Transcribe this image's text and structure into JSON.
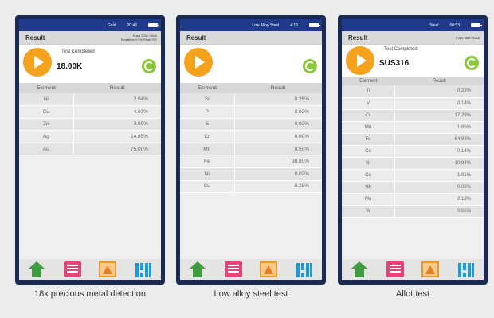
{
  "devices": [
    {
      "status_title": "Gold",
      "status_time": "20:46",
      "result_label": "Result",
      "params_line1": "0 cps 37kV 40uA",
      "params_line2": "Deadtime 0.5% Peak 971",
      "test_status": "Test Completed",
      "sample_name": "18.00K",
      "table_header": [
        "Element",
        "Result"
      ],
      "rows": [
        [
          "Ni",
          "2.04%"
        ],
        [
          "Cu",
          "4.03%"
        ],
        [
          "Zn",
          "3.99%"
        ],
        [
          "Ag",
          "14.85%"
        ],
        [
          "Au",
          "75.00%"
        ]
      ],
      "caption": "18k precious metal detection"
    },
    {
      "status_title": "Low Alloy Steel",
      "status_time": "4:16",
      "result_label": "Result",
      "params_line1": "",
      "params_line2": "",
      "test_status": "",
      "sample_name": "",
      "table_header": [
        "Element",
        "Result"
      ],
      "rows": [
        [
          "Si",
          "0.26%"
        ],
        [
          "P",
          "0.02%"
        ],
        [
          "S",
          "0.02%"
        ],
        [
          "Cr",
          "0.00%"
        ],
        [
          "Mn",
          "0.50%"
        ],
        [
          "Fe",
          "98.80%"
        ],
        [
          "Ni",
          "0.02%"
        ],
        [
          "Cu",
          "0.28%"
        ]
      ],
      "caption": "Low alloy steel test"
    },
    {
      "status_title": "Steel",
      "status_time": "00:53",
      "result_label": "Result",
      "params_line1": "0 cps 38kV 51uA",
      "params_line2": "",
      "test_status": "Test Completed",
      "sample_name": "SUS316",
      "table_header": [
        "Element",
        "Result"
      ],
      "rows": [
        [
          "Ti",
          "0.23%"
        ],
        [
          "V",
          "0.14%"
        ],
        [
          "Cr",
          "17.29%"
        ],
        [
          "Mn",
          "1.85%"
        ],
        [
          "Fe",
          "64.93%"
        ],
        [
          "Co",
          "0.14%"
        ],
        [
          "Ni",
          "10.94%"
        ],
        [
          "Cu",
          "1.01%"
        ],
        [
          "Nb",
          "0.06%"
        ],
        [
          "Mo",
          "2.13%"
        ],
        [
          "W",
          "0.06%"
        ]
      ],
      "caption": "Allot test"
    }
  ],
  "toolbar_icons": [
    "home-icon",
    "report-icon",
    "spectrum-icon",
    "bar-chart-icon"
  ],
  "colors": {
    "device_frame": "#1a2a52",
    "status_bar": "#1f3a8a",
    "play_button": "#f4a21e",
    "refresh_button": "#8cc63f"
  }
}
